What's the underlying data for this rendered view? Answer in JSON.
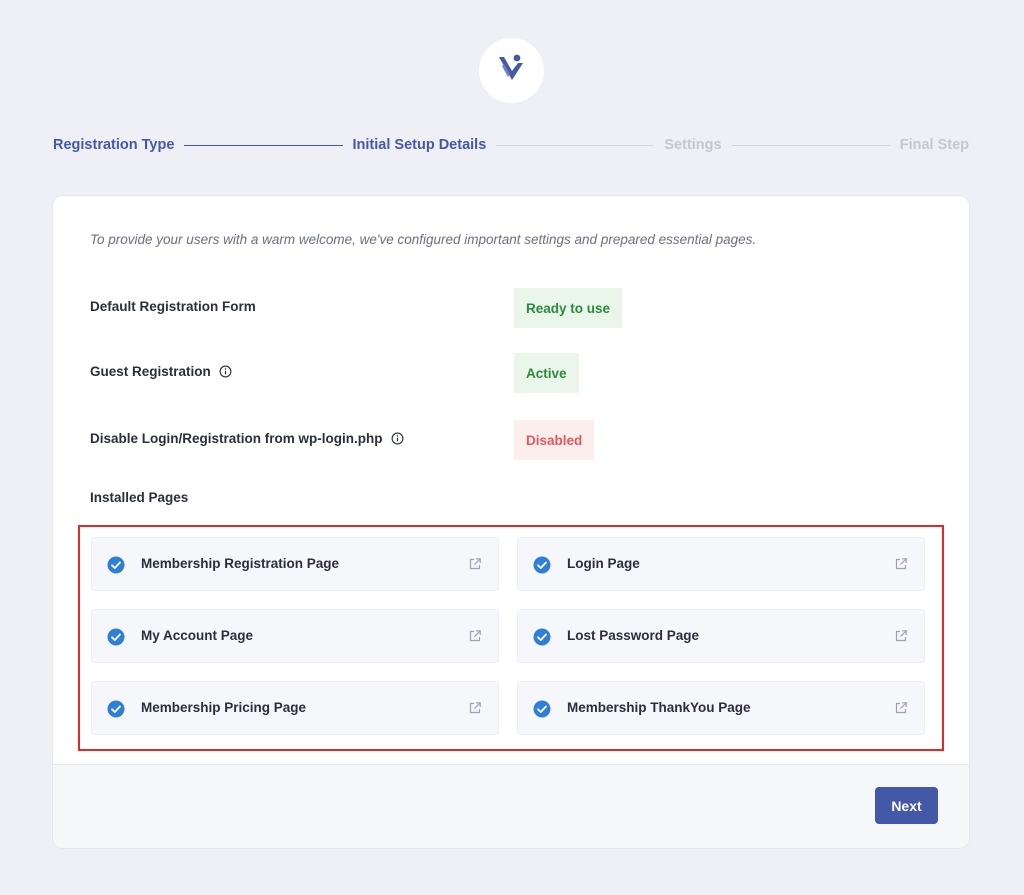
{
  "stepper": {
    "steps": [
      {
        "label": "Registration Type",
        "state": "done"
      },
      {
        "label": "Initial Setup Details",
        "state": "current"
      },
      {
        "label": "Settings",
        "state": "upcoming"
      },
      {
        "label": "Final Step",
        "state": "upcoming"
      }
    ]
  },
  "intro": "To provide your users with a warm welcome, we've configured important settings and prepared essential pages.",
  "settings": [
    {
      "label": "Default Registration Form",
      "status": "Ready to use",
      "status_color": "#2b8a3e",
      "has_info": false
    },
    {
      "label": "Guest Registration",
      "status": "Active",
      "status_color": "#2b8a3e",
      "has_info": true
    },
    {
      "label": "Disable Login/Registration from wp-login.php",
      "status": "Disabled",
      "status_color": "#e05a5a",
      "has_info": true
    }
  ],
  "installed_pages": {
    "heading": "Installed Pages",
    "items": [
      {
        "label": "Membership Registration Page",
        "icon": "check-circle-icon",
        "action_icon": "external-link-icon"
      },
      {
        "label": "Login Page",
        "icon": "check-circle-icon",
        "action_icon": "external-link-icon"
      },
      {
        "label": "My Account Page",
        "icon": "check-circle-icon",
        "action_icon": "external-link-icon"
      },
      {
        "label": "Lost Password Page",
        "icon": "check-circle-icon",
        "action_icon": "external-link-icon"
      },
      {
        "label": "Membership Pricing Page",
        "icon": "check-circle-icon",
        "action_icon": "external-link-icon"
      },
      {
        "label": "Membership ThankYou Page",
        "icon": "check-circle-icon",
        "action_icon": "external-link-icon"
      }
    ]
  },
  "footer": {
    "next_label": "Next"
  },
  "colors": {
    "accent": "#4458a8",
    "check": "#2f7fd8",
    "highlight_border": "#e02a2a"
  },
  "icons": {
    "logo": "brand-logo-icon"
  }
}
